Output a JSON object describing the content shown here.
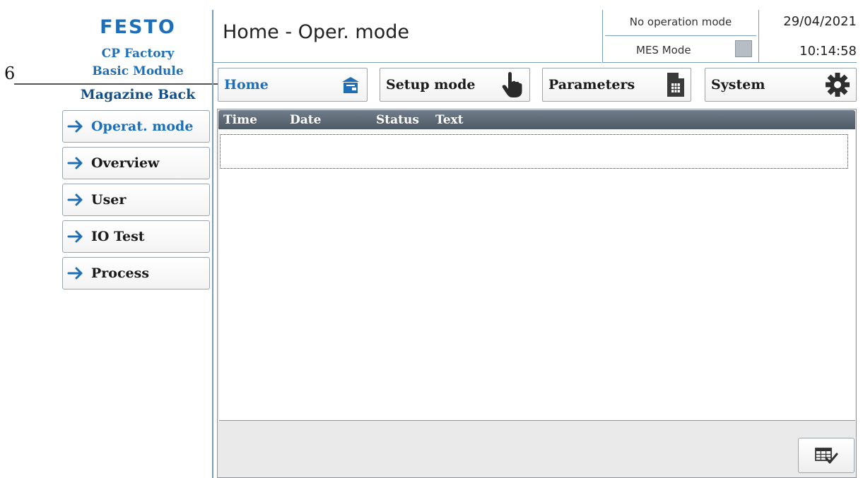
{
  "brand": {
    "logo": "FESTO",
    "line1": "CP Factory",
    "line2": "Basic Module",
    "station": "Magazine Back"
  },
  "annotation": {
    "number": "6"
  },
  "header": {
    "title": "Home - Oper. mode",
    "operation_mode": "No operation mode",
    "mes_mode_label": "MES Mode",
    "date": "29/04/2021",
    "time": "10:14:58"
  },
  "tabs": [
    {
      "label": "Home",
      "icon": "home-icon",
      "active": true
    },
    {
      "label": "Setup mode",
      "icon": "hand-pointer-icon",
      "active": false
    },
    {
      "label": "Parameters",
      "icon": "document-icon",
      "active": false
    },
    {
      "label": "System",
      "icon": "gear-icon",
      "active": false
    }
  ],
  "sidebar": {
    "items": [
      {
        "label": "Operat. mode",
        "active": true
      },
      {
        "label": "Overview",
        "active": false
      },
      {
        "label": "User",
        "active": false
      },
      {
        "label": "IO Test",
        "active": false
      },
      {
        "label": "Process",
        "active": false
      }
    ]
  },
  "log": {
    "columns": [
      "Time",
      "Date",
      "Status",
      "Text"
    ],
    "rows": []
  },
  "footer": {
    "ack_button_icon": "table-check-icon"
  },
  "colors": {
    "accent": "#1e6fb8",
    "header_bar": "#5a6672",
    "divider": "#7a9db8"
  }
}
